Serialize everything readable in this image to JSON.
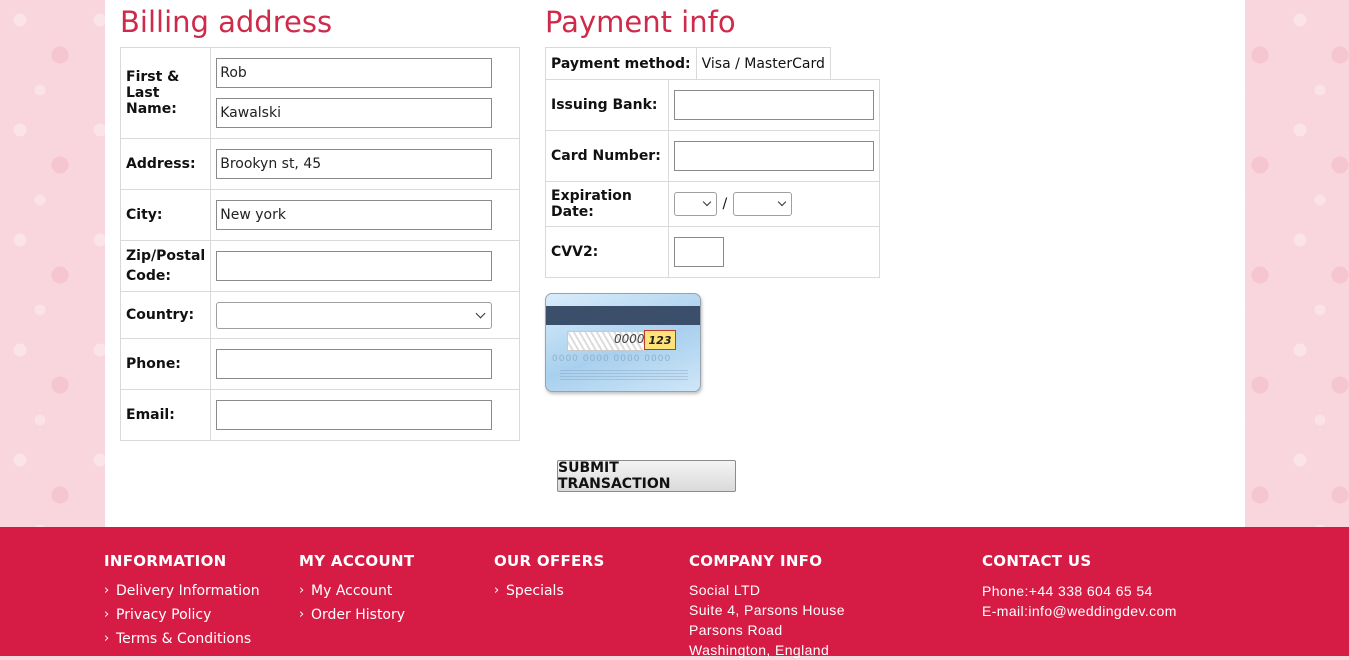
{
  "billing": {
    "title": "Billing address",
    "name_label": "First & Last Name:",
    "first_name": "Rob",
    "last_name": "Kawalski",
    "address_label": "Address:",
    "address": "Brookyn st, 45",
    "city_label": "City:",
    "city": "New york",
    "zip_label": "Zip/Postal Code:",
    "zip": "",
    "country_label": "Country:",
    "country": "",
    "phone_label": "Phone:",
    "phone": "",
    "email_label": "Email:",
    "email": ""
  },
  "payment": {
    "title": "Payment info",
    "method_label": "Payment method:",
    "method_value": "Visa / MasterCard",
    "bank_label": "Issuing Bank:",
    "bank": "",
    "card_label": "Card Number:",
    "card_number": "",
    "expiry_label": "Expiration Date:",
    "expiry_separator": "/",
    "expiry_month": "",
    "expiry_year": "",
    "cvv_label": "CVV2:",
    "cvv": "",
    "card_image": {
      "sample_number": "0000",
      "sample_cvv": "123",
      "digit_groups": "0000  0000  0000  0000"
    }
  },
  "submit_label": "SUBMIT TRANSACTION",
  "footer": {
    "information": {
      "title": "INFORMATION",
      "links": [
        "Delivery Information",
        "Privacy Policy",
        "Terms & Conditions"
      ]
    },
    "account": {
      "title": "MY ACCOUNT",
      "links": [
        "My Account",
        "Order History"
      ]
    },
    "offers": {
      "title": "OUR OFFERS",
      "links": [
        "Specials"
      ]
    },
    "company": {
      "title": "COMPANY INFO",
      "lines": [
        "Social LTD",
        "Suite 4, Parsons House",
        "Parsons Road",
        "Washington, England"
      ]
    },
    "contact": {
      "title": "CONTACT US",
      "phone": "Phone:+44 338 604 65 54",
      "email": "E-mail:info@weddingdev.com"
    }
  },
  "colors": {
    "accent": "#cf2a4a",
    "footer_bg": "#d61c45",
    "page_bg": "#f9d5dd"
  },
  "icons": {
    "link_bullet": "chevron-right-icon",
    "dropdown": "chevron-down-icon"
  }
}
